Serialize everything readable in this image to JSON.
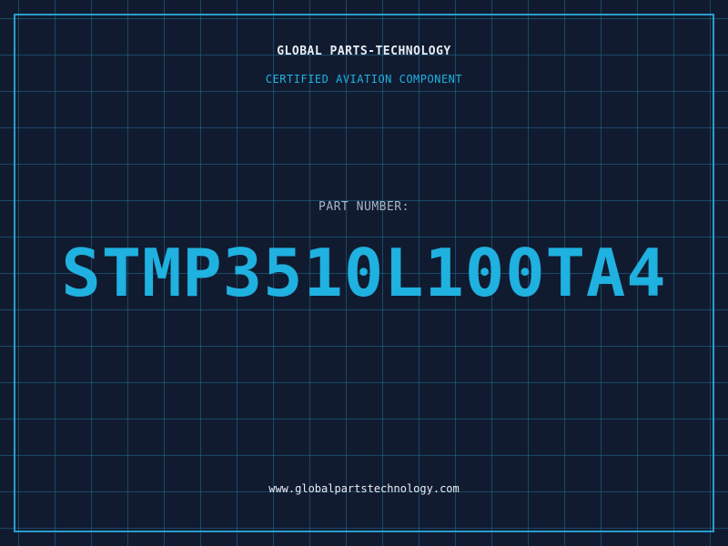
{
  "colors": {
    "background": "#111b30",
    "grid": "#1e6e96",
    "frame": "#2a9ccc",
    "accent": "#1fb1e0",
    "label": "#a9b4c4",
    "text": "#e8eef5"
  },
  "header": {
    "company": "GLOBAL PARTS-TECHNOLOGY",
    "certification": "CERTIFIED AVIATION COMPONENT"
  },
  "part": {
    "label": "PART NUMBER:",
    "number": "STMP3510L100TA4"
  },
  "footer": {
    "website": "www.globalpartstechnology.com"
  }
}
